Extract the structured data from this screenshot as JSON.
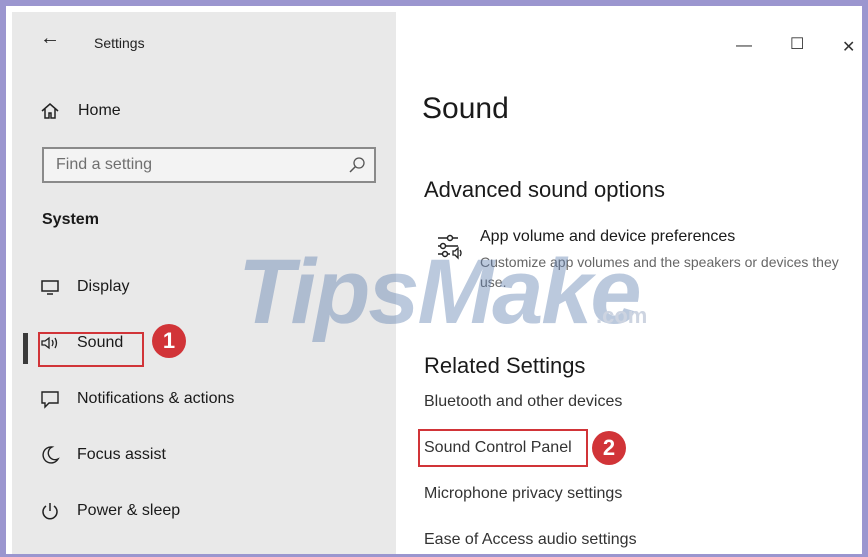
{
  "window": {
    "title": "Settings",
    "controls": {
      "minimize": "—",
      "maximize": "☐",
      "close": "✕"
    }
  },
  "sidebar": {
    "home_label": "Home",
    "search_placeholder": "Find a setting",
    "section_heading": "System",
    "items": [
      {
        "label": "Display",
        "icon": "monitor-icon"
      },
      {
        "label": "Sound",
        "icon": "speaker-icon",
        "selected": true,
        "step": "1"
      },
      {
        "label": "Notifications & actions",
        "icon": "notification-icon"
      },
      {
        "label": "Focus assist",
        "icon": "moon-icon"
      },
      {
        "label": "Power & sleep",
        "icon": "power-icon"
      }
    ]
  },
  "main": {
    "title": "Sound",
    "advanced": {
      "heading": "Advanced sound options",
      "item_title": "App volume and device preferences",
      "item_desc": "Customize app volumes and the speakers or devices they use."
    },
    "related": {
      "heading": "Related Settings",
      "links": [
        {
          "label": "Bluetooth and other devices"
        },
        {
          "label": "Sound Control Panel",
          "step": "2"
        },
        {
          "label": "Microphone privacy settings"
        },
        {
          "label": "Ease of Access audio settings"
        }
      ]
    }
  },
  "watermark": {
    "text": "TipsMake",
    "suffix": ".com"
  },
  "colors": {
    "highlight": "#d13438",
    "sidebar_bg": "#e9e9e9",
    "frame": "#9b96cf"
  }
}
